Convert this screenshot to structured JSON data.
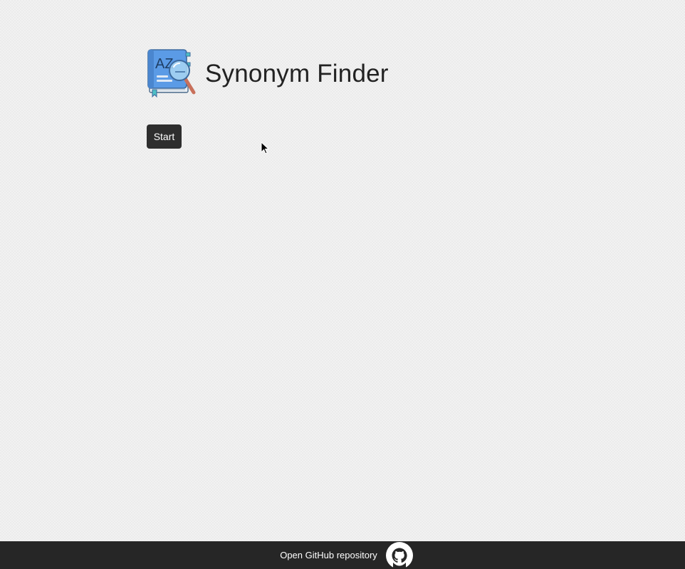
{
  "header": {
    "logo_icon": "dictionary-book-magnifier-icon",
    "title": "Synonym Finder",
    "logo_text": "AZ"
  },
  "controls": {
    "start_label": "Start"
  },
  "footer": {
    "link_label": "Open GitHub repository",
    "icon": "github-icon"
  },
  "colors": {
    "button_bg": "#2e2e2e",
    "footer_bg": "#262626",
    "book_blue": "#5b9be6",
    "handle": "#c8705b"
  }
}
